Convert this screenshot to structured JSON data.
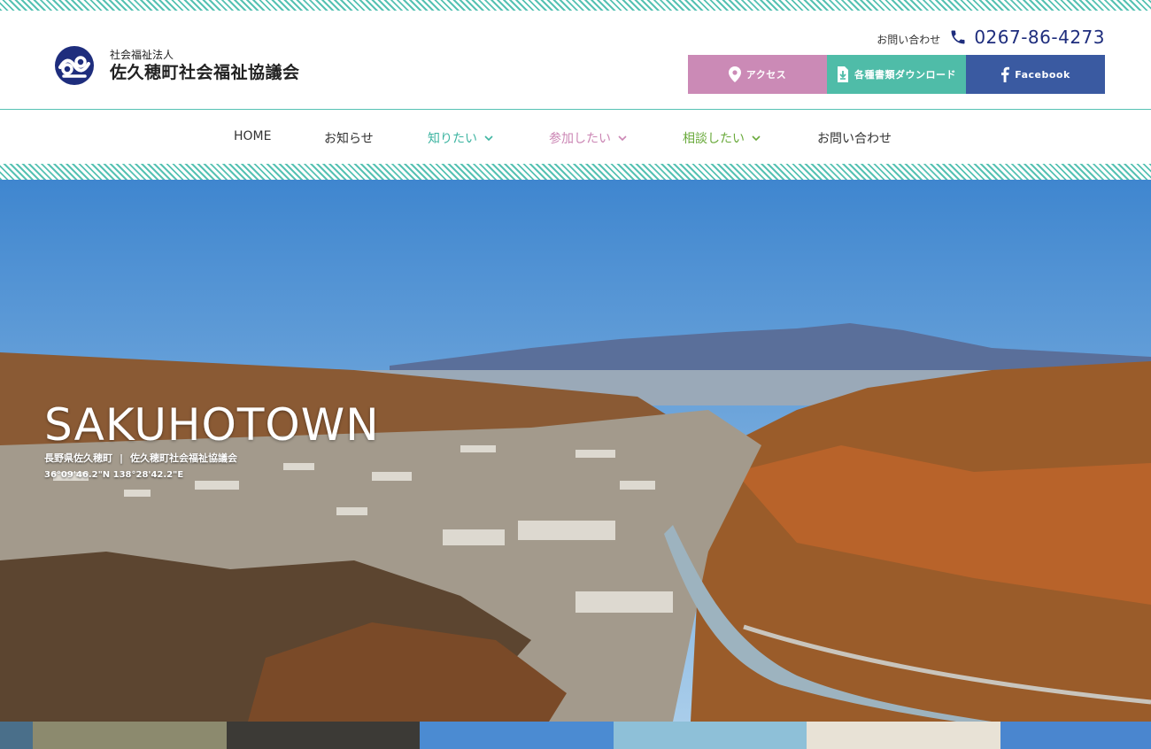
{
  "header": {
    "org_type": "社会福祉法人",
    "org_name": "佐久穂町社会福祉協議会",
    "contact_label": "お問い合わせ",
    "phone": "0267-86-4273",
    "buttons": [
      {
        "label": "アクセス",
        "icon": "map-pin-icon",
        "color": "#cb8ab6"
      },
      {
        "label": "各種書類ダウンロード",
        "icon": "download-icon",
        "color": "#4fbca8"
      },
      {
        "label": "Facebook",
        "icon": "facebook-icon",
        "color": "#3a5aa1"
      }
    ]
  },
  "nav": {
    "items": [
      {
        "label": "HOME"
      },
      {
        "label": "お知らせ"
      },
      {
        "label": "知りたい",
        "dropdown": true,
        "color": "#3fb5a2"
      },
      {
        "label": "参加したい",
        "dropdown": true,
        "color": "#cb86b4"
      },
      {
        "label": "相談したい",
        "dropdown": true,
        "color": "#6aaa3c"
      },
      {
        "label": "お問い合わせ"
      }
    ]
  },
  "hero": {
    "title": "SAKUHOTOWN",
    "location": "長野県佐久穂町",
    "separator": "|",
    "org": "佐久穂町社会福祉協議会",
    "coordinates": "36°09'46.2\"N 138°28'42.2\"E"
  },
  "colors": {
    "accent_teal": "#56c2b3",
    "brand_navy": "#1e2d7d"
  }
}
